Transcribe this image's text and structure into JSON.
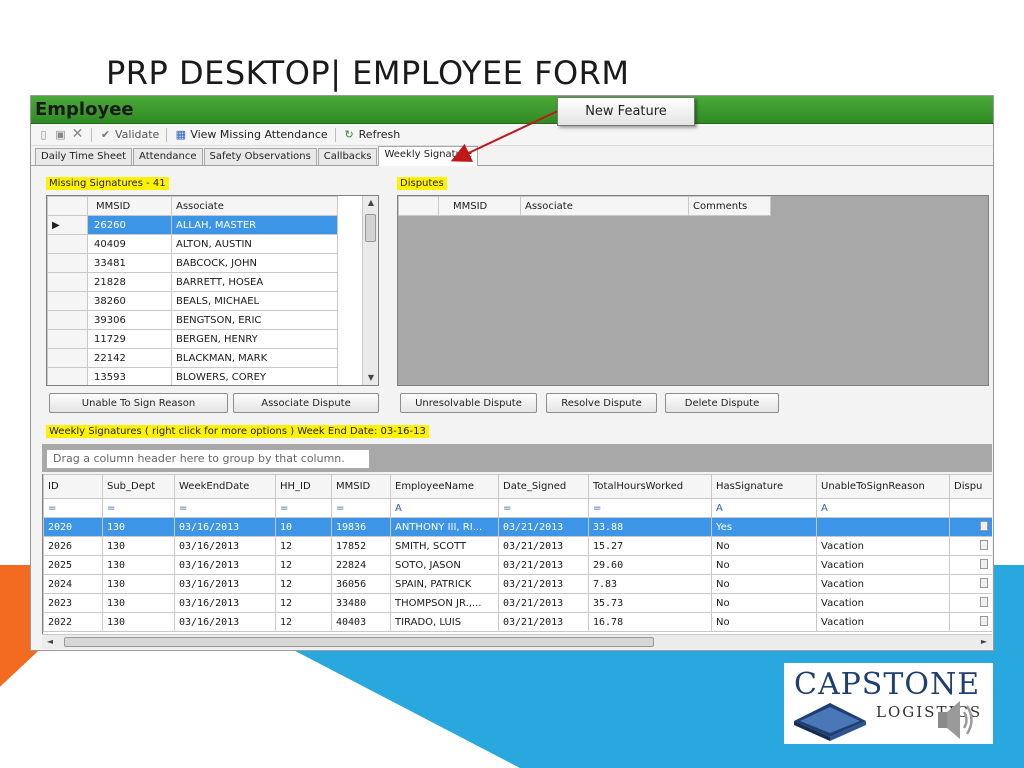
{
  "slide_title": "PRP DESKTOP| EMPLOYEE FORM",
  "app": {
    "title": "Employee",
    "toolbar": {
      "validate_label": "Validate",
      "view_missing_label": "View Missing Attendance",
      "refresh_label": "Refresh"
    },
    "tabs": [
      "Daily Time Sheet",
      "Attendance",
      "Safety Observations",
      "Callbacks",
      "Weekly Signature"
    ],
    "active_tab": "Weekly Signature"
  },
  "callout": {
    "text": "New Feature"
  },
  "missing": {
    "label": "Missing Signatures - 41",
    "columns": [
      "MMSID",
      "Associate"
    ],
    "rows": [
      [
        "26260",
        "ALLAH, MASTER"
      ],
      [
        "40409",
        "ALTON, AUSTIN"
      ],
      [
        "33481",
        "BABCOCK, JOHN"
      ],
      [
        "21828",
        "BARRETT, HOSEA"
      ],
      [
        "38260",
        "BEALS, MICHAEL"
      ],
      [
        "39306",
        "BENGTSON, ERIC"
      ],
      [
        "11729",
        "BERGEN, HENRY"
      ],
      [
        "22142",
        "BLACKMAN, MARK"
      ],
      [
        "13593",
        "BLOWERS, COREY"
      ]
    ],
    "buttons": {
      "unable": "Unable To Sign Reason",
      "dispute": "Associate Dispute"
    }
  },
  "disputes": {
    "label": "Disputes",
    "columns": [
      "MMSID",
      "Associate",
      "Comments"
    ],
    "buttons": {
      "unresolvable": "Unresolvable Dispute",
      "resolve": "Resolve Dispute",
      "delete": "Delete Dispute"
    }
  },
  "weekly": {
    "label": "Weekly Signatures ( right click for more options ) Week End Date: 03-16-13",
    "group_hint": "Drag a column header here to group by that column.",
    "columns": [
      "ID",
      "Sub_Dept",
      "WeekEndDate",
      "HH_ID",
      "MMSID",
      "EmployeeName",
      "Date_Signed",
      "TotalHoursWorked",
      "HasSignature",
      "UnableToSignReason",
      "Dispu"
    ],
    "filter_row": [
      "=",
      "=",
      "=",
      "=",
      "=",
      "A",
      "=",
      "=",
      "A",
      "A",
      ""
    ],
    "rows": [
      [
        "2020",
        "130",
        "03/16/2013",
        "10",
        "19836",
        "ANTHONY III, RI...",
        "03/21/2013",
        "33.88",
        "Yes",
        ""
      ],
      [
        "2026",
        "130",
        "03/16/2013",
        "12",
        "17852",
        "SMITH, SCOTT",
        "03/21/2013",
        "15.27",
        "No",
        "Vacation"
      ],
      [
        "2025",
        "130",
        "03/16/2013",
        "12",
        "22824",
        "SOTO, JASON",
        "03/21/2013",
        "29.60",
        "No",
        "Vacation"
      ],
      [
        "2024",
        "130",
        "03/16/2013",
        "12",
        "36056",
        "SPAIN, PATRICK",
        "03/21/2013",
        "7.83",
        "No",
        "Vacation"
      ],
      [
        "2023",
        "130",
        "03/16/2013",
        "12",
        "33480",
        "THOMPSON JR.,...",
        "03/21/2013",
        "35.73",
        "No",
        "Vacation"
      ],
      [
        "2022",
        "130",
        "03/16/2013",
        "12",
        "40403",
        "TIRADO, LUIS",
        "03/21/2013",
        "16.78",
        "No",
        "Vacation"
      ]
    ]
  },
  "logo": {
    "name": "CAPSTONE",
    "sub": "LOGISTICS"
  },
  "colors": {
    "header_green": "#2f8a24",
    "highlight_yellow": "#fff200",
    "selection_blue": "#3d95e8",
    "slide_blue": "#28a8df",
    "slide_orange": "#f26b21"
  }
}
